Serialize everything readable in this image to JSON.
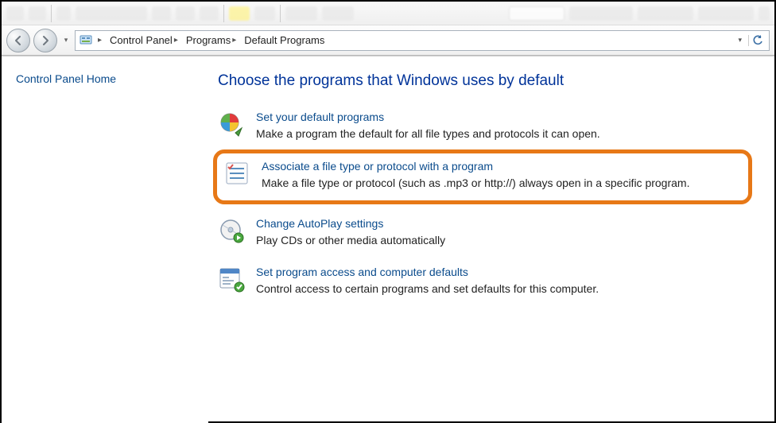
{
  "breadcrumbs": [
    "Control Panel",
    "Programs",
    "Default Programs"
  ],
  "sidebar": {
    "home_link": "Control Panel Home"
  },
  "heading": "Choose the programs that Windows uses by default",
  "items": [
    {
      "title": "Set your default programs",
      "desc": "Make a program the default for all file types and protocols it can open."
    },
    {
      "title": "Associate a file type or protocol with a program",
      "desc": "Make a file type or protocol (such as .mp3 or http://) always open in a specific program."
    },
    {
      "title": "Change AutoPlay settings",
      "desc": "Play CDs or other media automatically"
    },
    {
      "title": "Set program access and computer defaults",
      "desc": "Control access to certain programs and set defaults for this computer."
    }
  ]
}
